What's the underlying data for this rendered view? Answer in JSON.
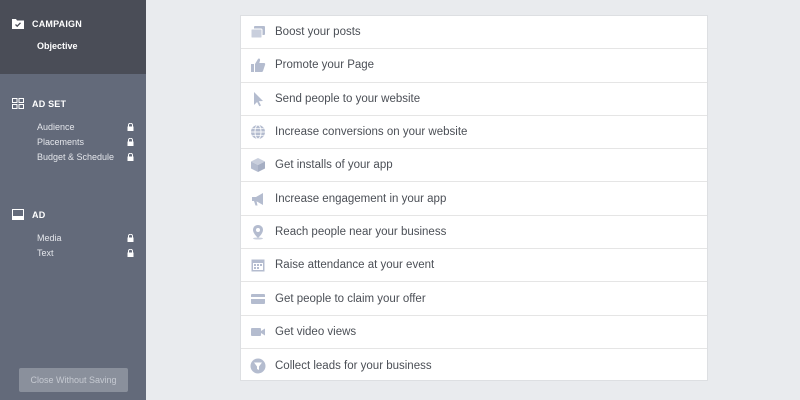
{
  "sidebar": {
    "campaign": {
      "title": "CAMPAIGN",
      "items": [
        {
          "label": "Objective"
        }
      ]
    },
    "ad_set": {
      "title": "AD SET",
      "items": [
        {
          "label": "Audience"
        },
        {
          "label": "Placements"
        },
        {
          "label": "Budget & Schedule"
        }
      ]
    },
    "ad": {
      "title": "AD",
      "items": [
        {
          "label": "Media"
        },
        {
          "label": "Text"
        }
      ]
    },
    "close_button": "Close Without Saving"
  },
  "objectives": [
    {
      "label": "Boost your posts",
      "icon": "posts-icon"
    },
    {
      "label": "Promote your Page",
      "icon": "thumbs-up-icon"
    },
    {
      "label": "Send people to your website",
      "icon": "cursor-icon"
    },
    {
      "label": "Increase conversions on your website",
      "icon": "globe-icon"
    },
    {
      "label": "Get installs of your app",
      "icon": "box-icon"
    },
    {
      "label": "Increase engagement in your app",
      "icon": "megaphone-icon"
    },
    {
      "label": "Reach people near your business",
      "icon": "map-pin-icon"
    },
    {
      "label": "Raise attendance at your event",
      "icon": "calendar-icon"
    },
    {
      "label": "Get people to claim your offer",
      "icon": "ticket-icon"
    },
    {
      "label": "Get video views",
      "icon": "video-camera-icon"
    },
    {
      "label": "Collect leads for your business",
      "icon": "funnel-icon"
    }
  ],
  "colors": {
    "icon": "#b4bccf",
    "sidebar": "#636a7a",
    "sidebar_active": "#4a4d57"
  }
}
